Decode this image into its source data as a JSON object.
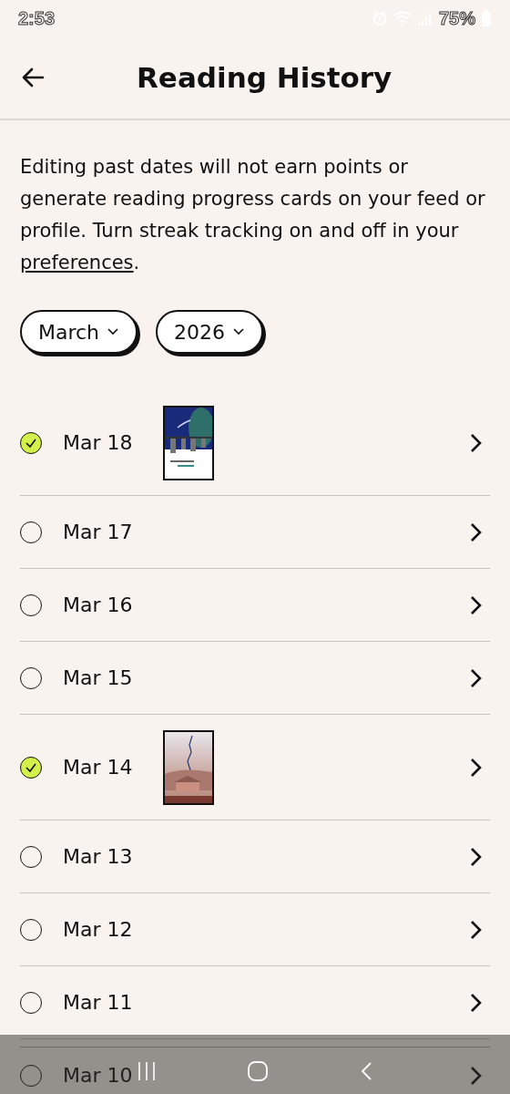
{
  "status_bar": {
    "time": "2:53",
    "battery": "75%"
  },
  "header": {
    "title": "Reading History"
  },
  "notice": {
    "text_before": "Editing past dates will not earn points or generate reading progress cards on your feed or profile. Turn streak tracking on and off in your ",
    "link": "preferences",
    "text_after": "."
  },
  "filters": [
    {
      "label": "March"
    },
    {
      "label": "2026"
    }
  ],
  "days": [
    {
      "date": "Mar 18",
      "read": true
    },
    {
      "date": "Mar 17",
      "read": false
    },
    {
      "date": "Mar 16",
      "read": false
    },
    {
      "date": "Mar 15",
      "read": false
    },
    {
      "date": "Mar 14",
      "read": true
    },
    {
      "date": "Mar 13",
      "read": false
    },
    {
      "date": "Mar 12",
      "read": false
    },
    {
      "date": "Mar 11",
      "read": false
    },
    {
      "date": "Mar 10",
      "read": false
    }
  ]
}
